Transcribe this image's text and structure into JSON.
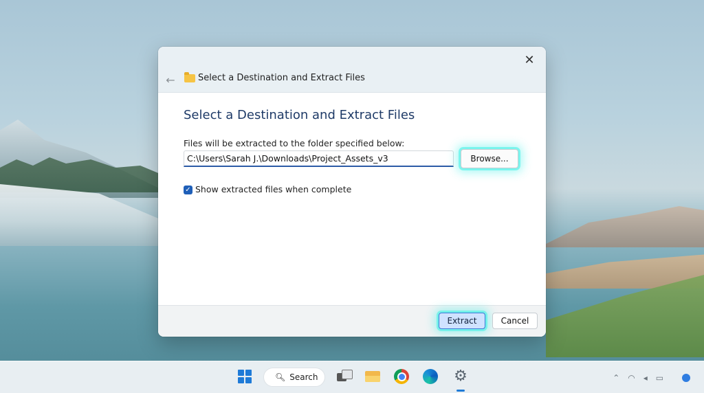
{
  "dialog": {
    "title": "Select a Destination and Extract Files",
    "heading": "Select a Destination and Extract Files",
    "path_label": "Files will be extracted to the folder specified below:",
    "path_value": "C:\\Users\\Sarah J.\\Downloads\\Project_Assets_v3",
    "browse_label": "Browse...",
    "checkbox_label": "Show extracted files when complete",
    "checkbox_checked": true,
    "extract_label": "Extract",
    "cancel_label": "Cancel",
    "close_icon": "close-icon",
    "back_icon": "back-arrow-icon",
    "folder_icon": "folder-icon"
  },
  "taskbar": {
    "search_label": "Search",
    "icons": [
      "windows-start-icon",
      "search-icon",
      "task-view-icon",
      "file-explorer-icon",
      "chrome-icon",
      "edge-icon",
      "settings-icon"
    ],
    "accent": "#1e7ad7"
  },
  "colors": {
    "highlight_glow": "#40f0e6",
    "heading": "#1e3a67",
    "primary_button": "#cfe2ff"
  }
}
